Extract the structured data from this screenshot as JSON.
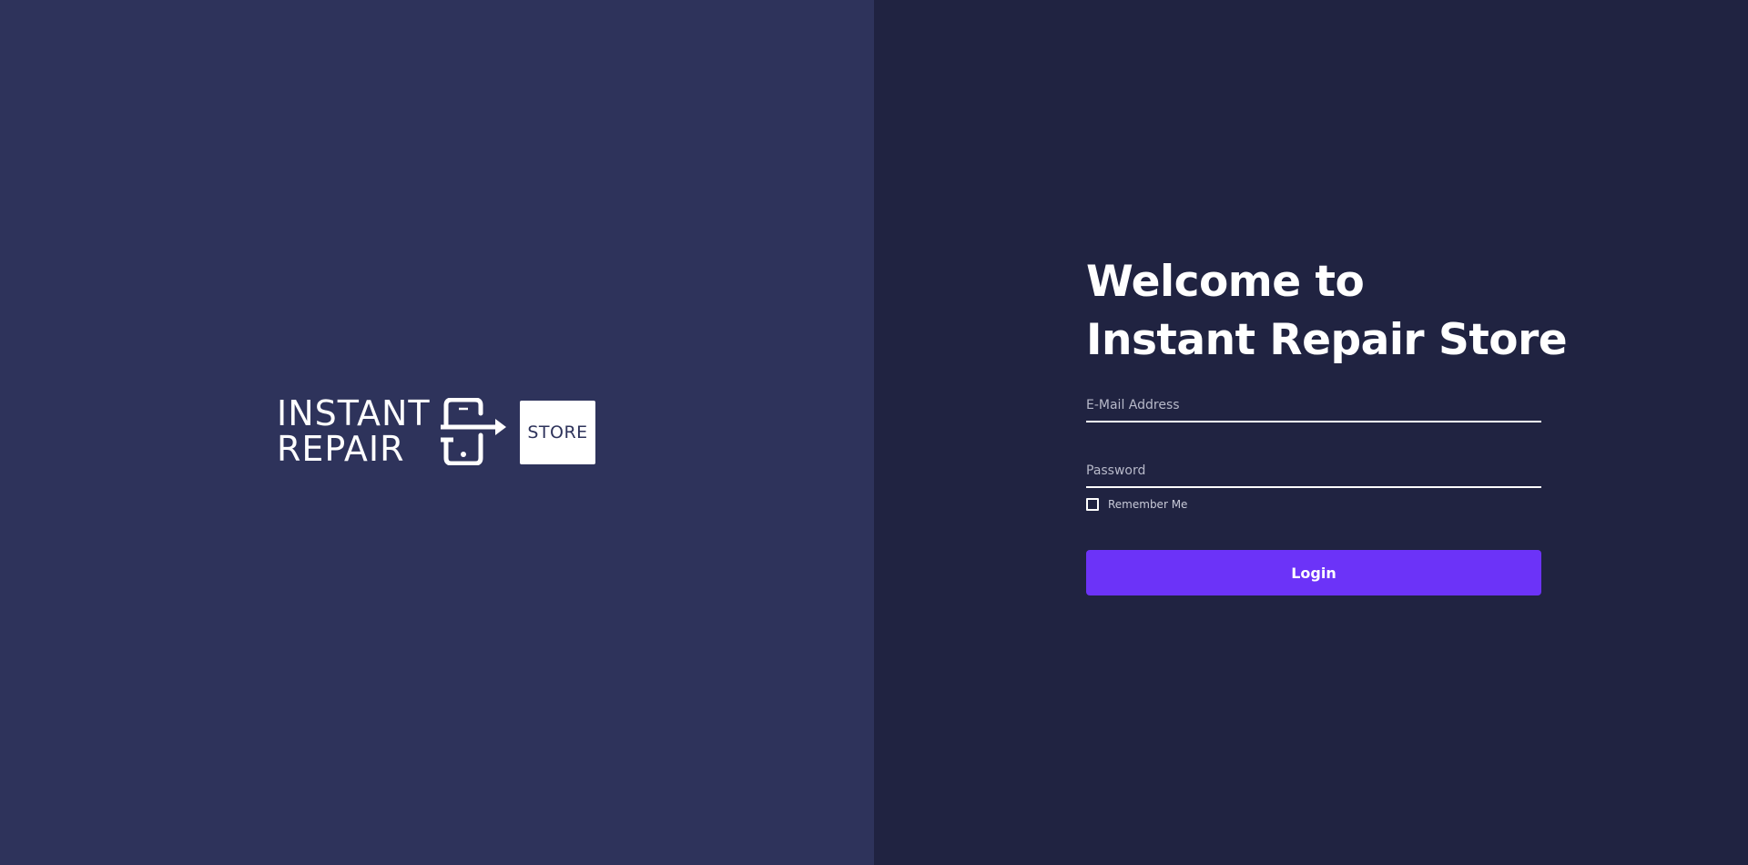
{
  "logo": {
    "line1": "INSTANT",
    "line2": "REPAIR",
    "store": "STORE",
    "icon": "phone-transfer-icon"
  },
  "form": {
    "title_line1": "Welcome to",
    "title_line2": "Instant Repair Store",
    "email_placeholder": "E-Mail Address",
    "email_value": "",
    "password_placeholder": "Password",
    "password_value": "",
    "remember_label": "Remember Me",
    "remember_checked": false,
    "login_label": "Login"
  },
  "colors": {
    "left_bg": "#2e335b",
    "right_bg": "#202341",
    "accent": "#6c33f8",
    "text": "#ffffff"
  }
}
